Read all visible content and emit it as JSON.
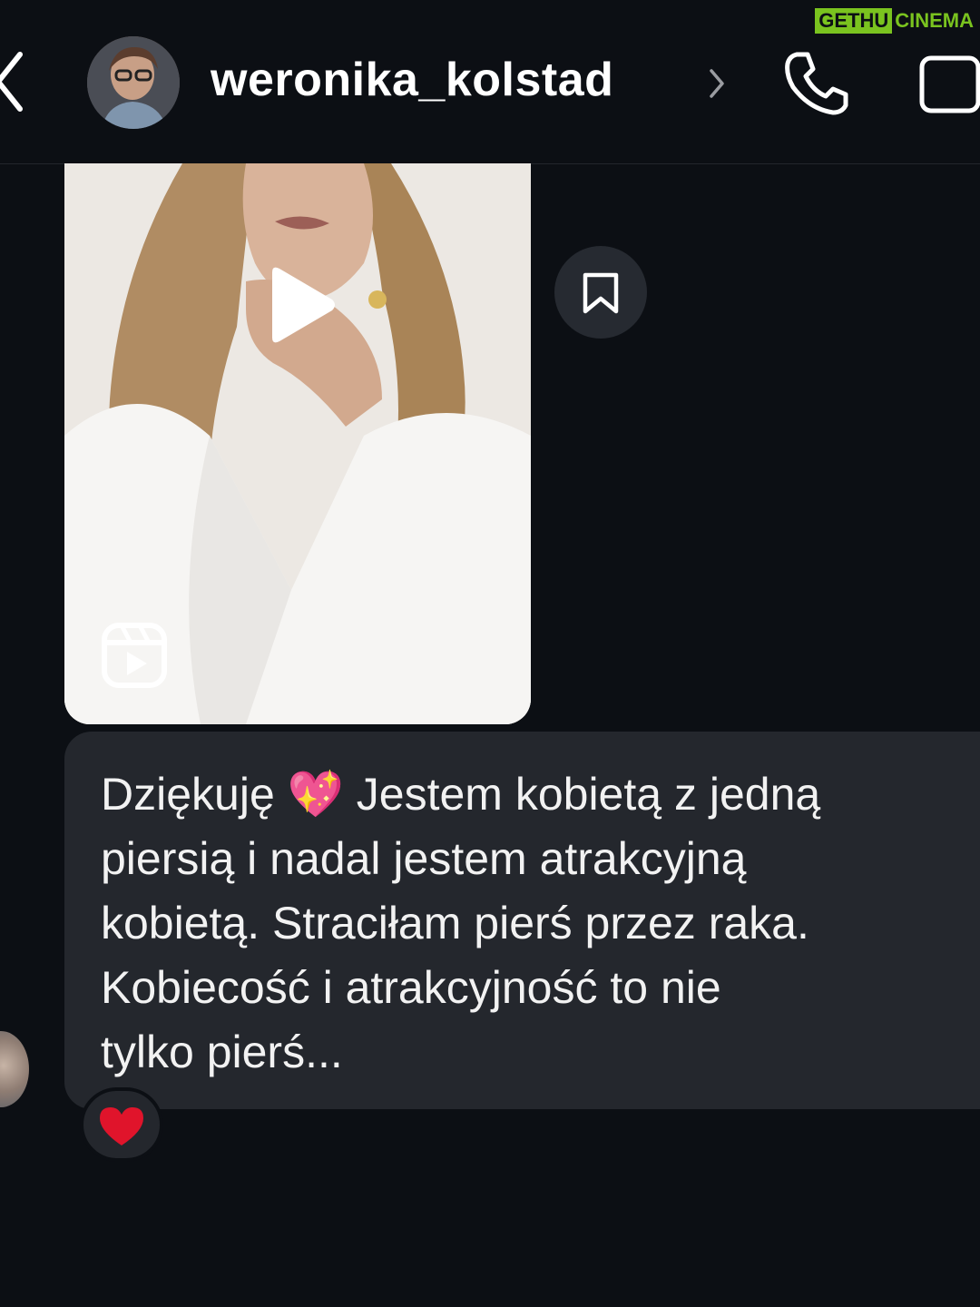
{
  "header": {
    "username": "weronika_kolstad",
    "back_icon": "chevron-left-icon",
    "profile_chevron_icon": "chevron-right-icon",
    "call_icon": "phone-icon",
    "video_icon": "video-camera-icon"
  },
  "watermark": {
    "part1": "GETHU",
    "part2": "CINEMA",
    "color": "#7ac31f"
  },
  "video_message": {
    "play_icon": "play-icon",
    "reels_icon": "reels-icon",
    "save_icon": "bookmark-icon"
  },
  "message": {
    "lines": [
      "Dziękuję 💖 Jestem kobietą z jedną",
      "piersią i nadal jestem atrakcyjną",
      "kobietą. Straciłam pierś przez raka.",
      "Kobiecość i atrakcyjność to nie",
      "tylko pierś..."
    ],
    "reaction": "❤️"
  },
  "colors": {
    "background": "#0c0f14",
    "bubble": "#24272d",
    "reaction_heart": "#e0142b"
  }
}
